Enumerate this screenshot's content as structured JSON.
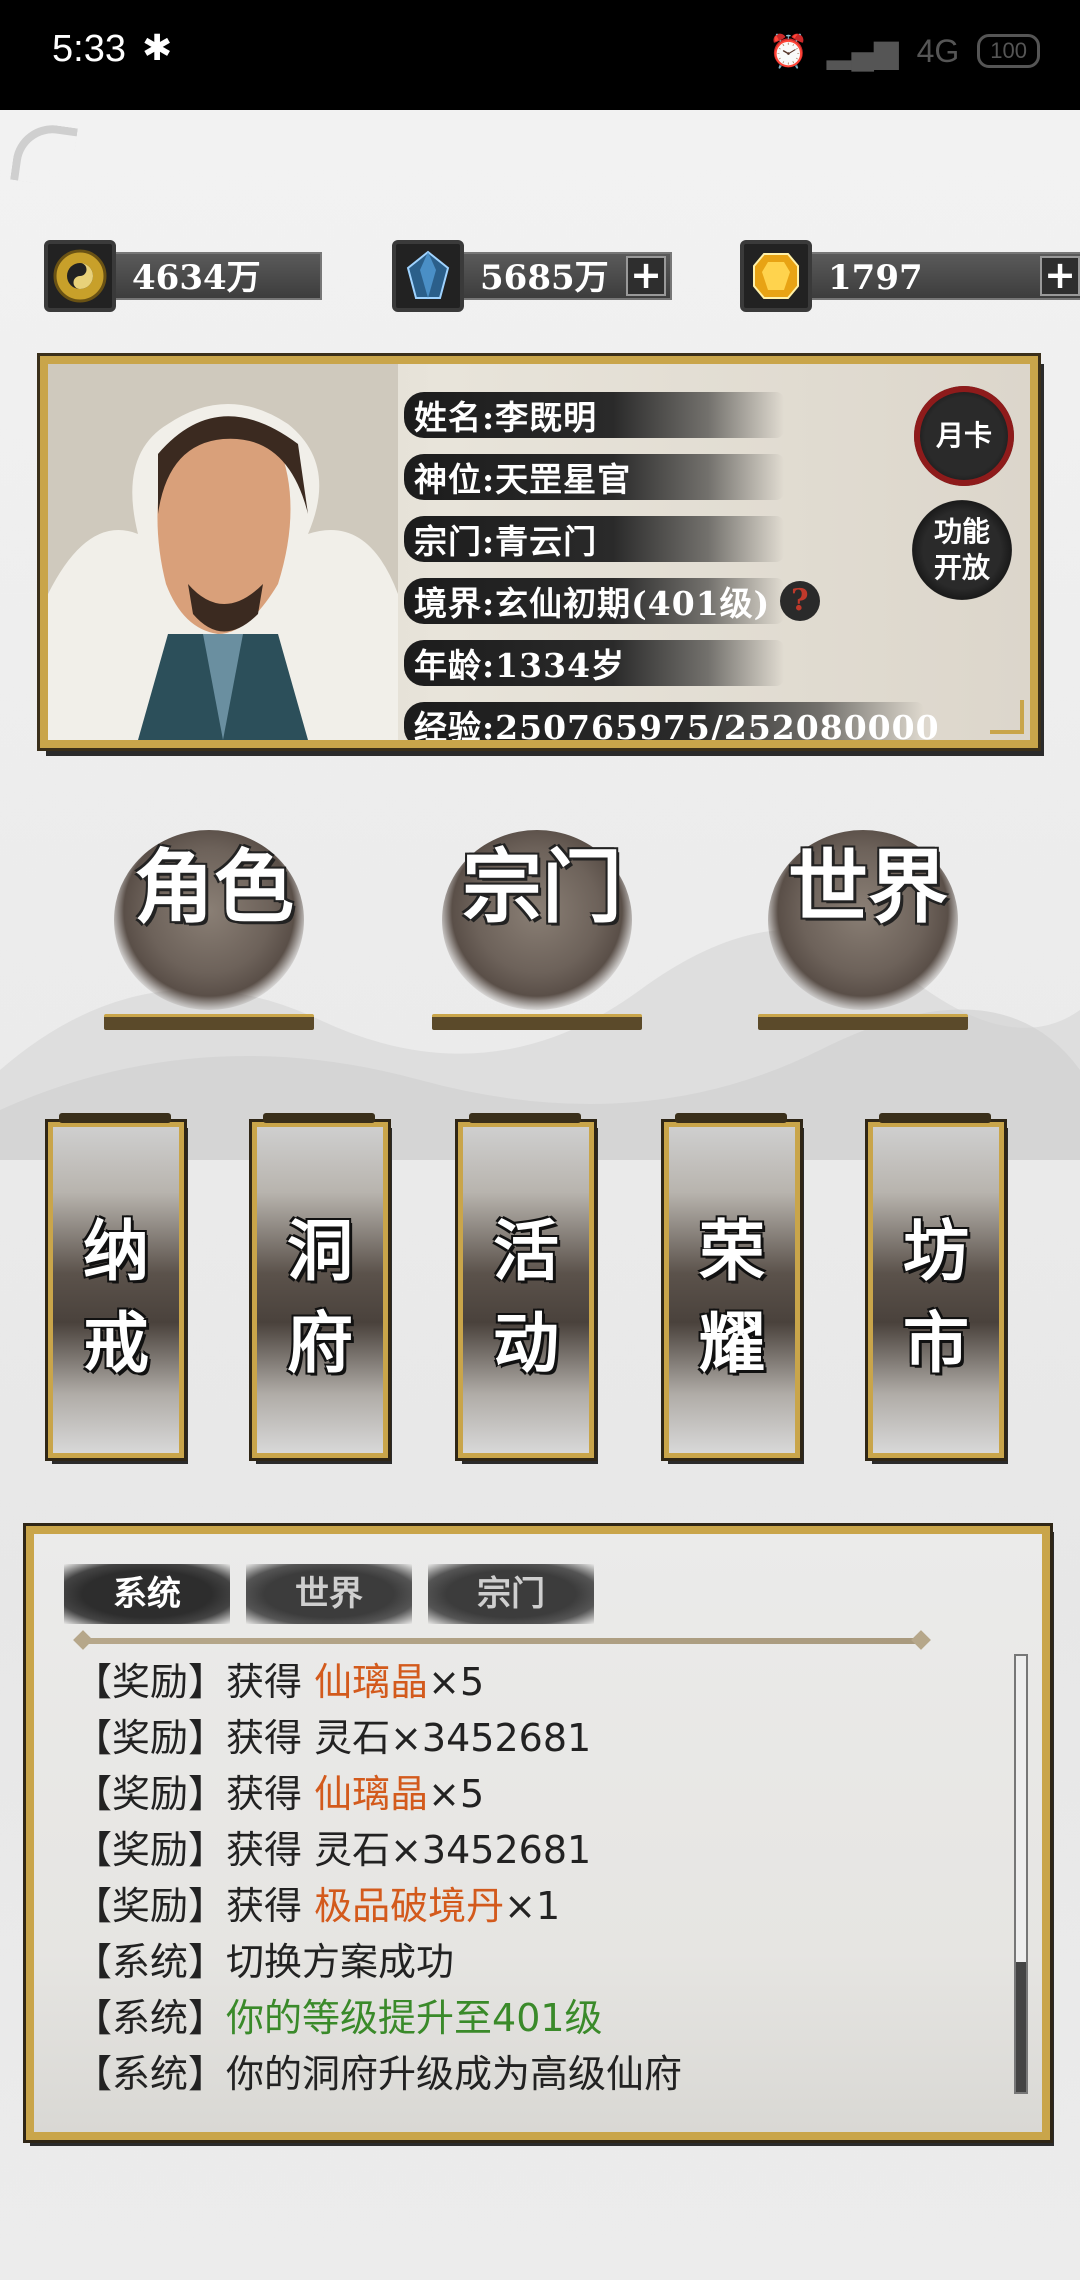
{
  "status_bar": {
    "time": "5:33",
    "bluetooth_icon": "bluetooth-icon",
    "network": "4G",
    "battery": "100"
  },
  "currency": [
    {
      "icon": "taiji-coin-icon",
      "value": "4634万",
      "has_plus": false
    },
    {
      "icon": "blue-crystal-icon",
      "value": "5685万",
      "has_plus": true
    },
    {
      "icon": "gold-gem-icon",
      "value": "1797",
      "has_plus": true
    }
  ],
  "profile": {
    "name": "姓名:李既明",
    "rank": "神位:天罡星官",
    "sect": "宗门:青云门",
    "realm": "境界:玄仙初期(401级)",
    "age": "年龄:1334岁",
    "exp": "经验:250765975/252080000",
    "help": "?",
    "month_card": "月卡",
    "feature_open": "功能开放"
  },
  "main_buttons": [
    {
      "label": "角色"
    },
    {
      "label": "宗门"
    },
    {
      "label": "世界"
    }
  ],
  "scroll_buttons": [
    {
      "label": "纳戒"
    },
    {
      "label": "洞府"
    },
    {
      "label": "活动"
    },
    {
      "label": "荣耀"
    },
    {
      "label": "坊市"
    }
  ],
  "log_tabs": [
    "系统",
    "世界",
    "宗门"
  ],
  "log": [
    {
      "tag": "【奖励】",
      "text": "获得 ",
      "highlight": "仙璃晶",
      "tail": "×5",
      "color": "orange"
    },
    {
      "tag": "【奖励】",
      "text": "获得 灵石×3452681",
      "highlight": "",
      "tail": "",
      "color": ""
    },
    {
      "tag": "【奖励】",
      "text": "获得 ",
      "highlight": "仙璃晶",
      "tail": "×5",
      "color": "orange"
    },
    {
      "tag": "【奖励】",
      "text": "获得 灵石×3452681",
      "highlight": "",
      "tail": "",
      "color": ""
    },
    {
      "tag": "【奖励】",
      "text": "获得 ",
      "highlight": "极品破境丹",
      "tail": "×1",
      "color": "orange"
    },
    {
      "tag": "【系统】",
      "text": "切换方案成功",
      "highlight": "",
      "tail": "",
      "color": ""
    },
    {
      "tag": "【系统】",
      "text": "",
      "highlight": "你的等级提升至401级",
      "tail": "",
      "color": "green"
    },
    {
      "tag": "【系统】",
      "text": "你的洞府升级成为高级仙府",
      "highlight": "",
      "tail": "",
      "color": ""
    }
  ],
  "colors": {
    "gold_frame": "#c9a54a",
    "orange": "#d35a1c",
    "green": "#3a8a2a"
  }
}
